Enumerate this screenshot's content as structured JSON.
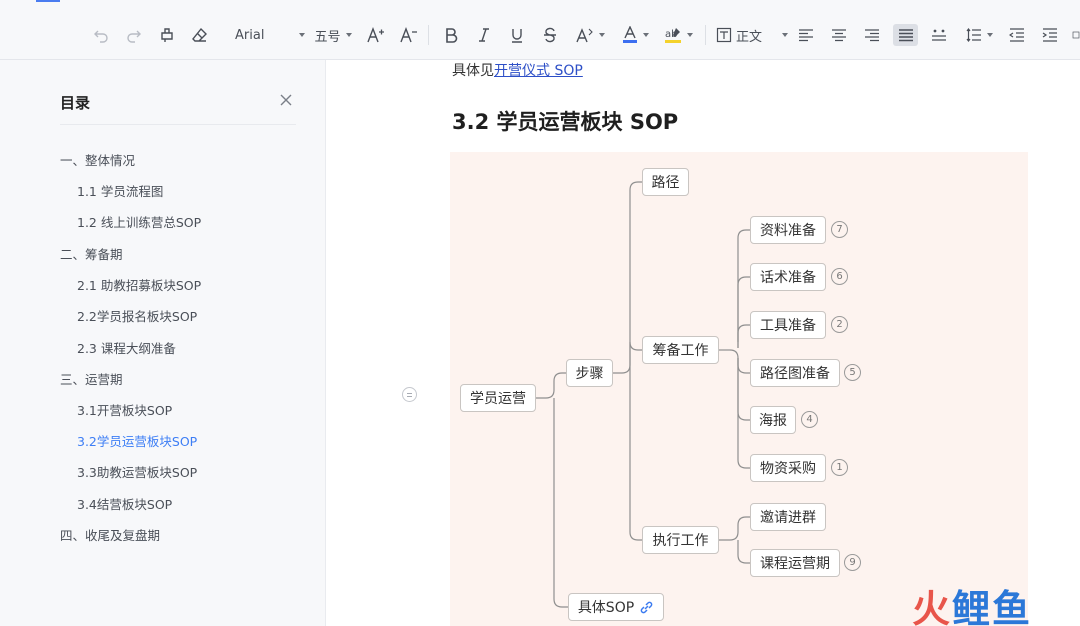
{
  "toolbar": {
    "font_name": "Arial",
    "font_size": "五号",
    "paragraph_style": "正文"
  },
  "toc": {
    "title": "目录",
    "items": [
      {
        "label": "一、整体情况",
        "level": 1
      },
      {
        "label": "1.1 学员流程图",
        "level": 2
      },
      {
        "label": "1.2 线上训练营总SOP",
        "level": 2
      },
      {
        "label": "二、筹备期",
        "level": 1
      },
      {
        "label": "2.1 助教招募板块SOP",
        "level": 2
      },
      {
        "label": "2.2学员报名板块SOP",
        "level": 2
      },
      {
        "label": "2.3 课程大纲准备",
        "level": 2
      },
      {
        "label": "三、运营期",
        "level": 1
      },
      {
        "label": "3.1开营板块SOP",
        "level": 2
      },
      {
        "label": "3.2学员运营板块SOP",
        "level": 2,
        "active": true
      },
      {
        "label": "3.3助教运营板块SOP",
        "level": 2
      },
      {
        "label": "3.4结营板块SOP",
        "level": 2
      },
      {
        "label": "四、收尾及复盘期",
        "level": 1
      }
    ]
  },
  "content": {
    "intro_prefix": "具体见",
    "intro_link": "开营仪式 SOP",
    "heading": "3.2 学员运营板块 SOP"
  },
  "mindmap": {
    "root": "学员运营",
    "steps": "步骤",
    "path": "路径",
    "prep": "筹备工作",
    "exec": "执行工作",
    "detail_sop": "具体SOP",
    "prep_children": [
      {
        "label": "资料准备",
        "badge": "7"
      },
      {
        "label": "话术准备",
        "badge": "6"
      },
      {
        "label": "工具准备",
        "badge": "2"
      },
      {
        "label": "路径图准备",
        "badge": "5"
      },
      {
        "label": "海报",
        "badge": "4"
      },
      {
        "label": "物资采购",
        "badge": "1"
      }
    ],
    "exec_children": [
      {
        "label": "邀请进群",
        "badge": ""
      },
      {
        "label": "课程运营期",
        "badge": "9"
      }
    ]
  },
  "watermark": {
    "part1": "火",
    "part2": "鲤",
    "part3": "鱼"
  }
}
